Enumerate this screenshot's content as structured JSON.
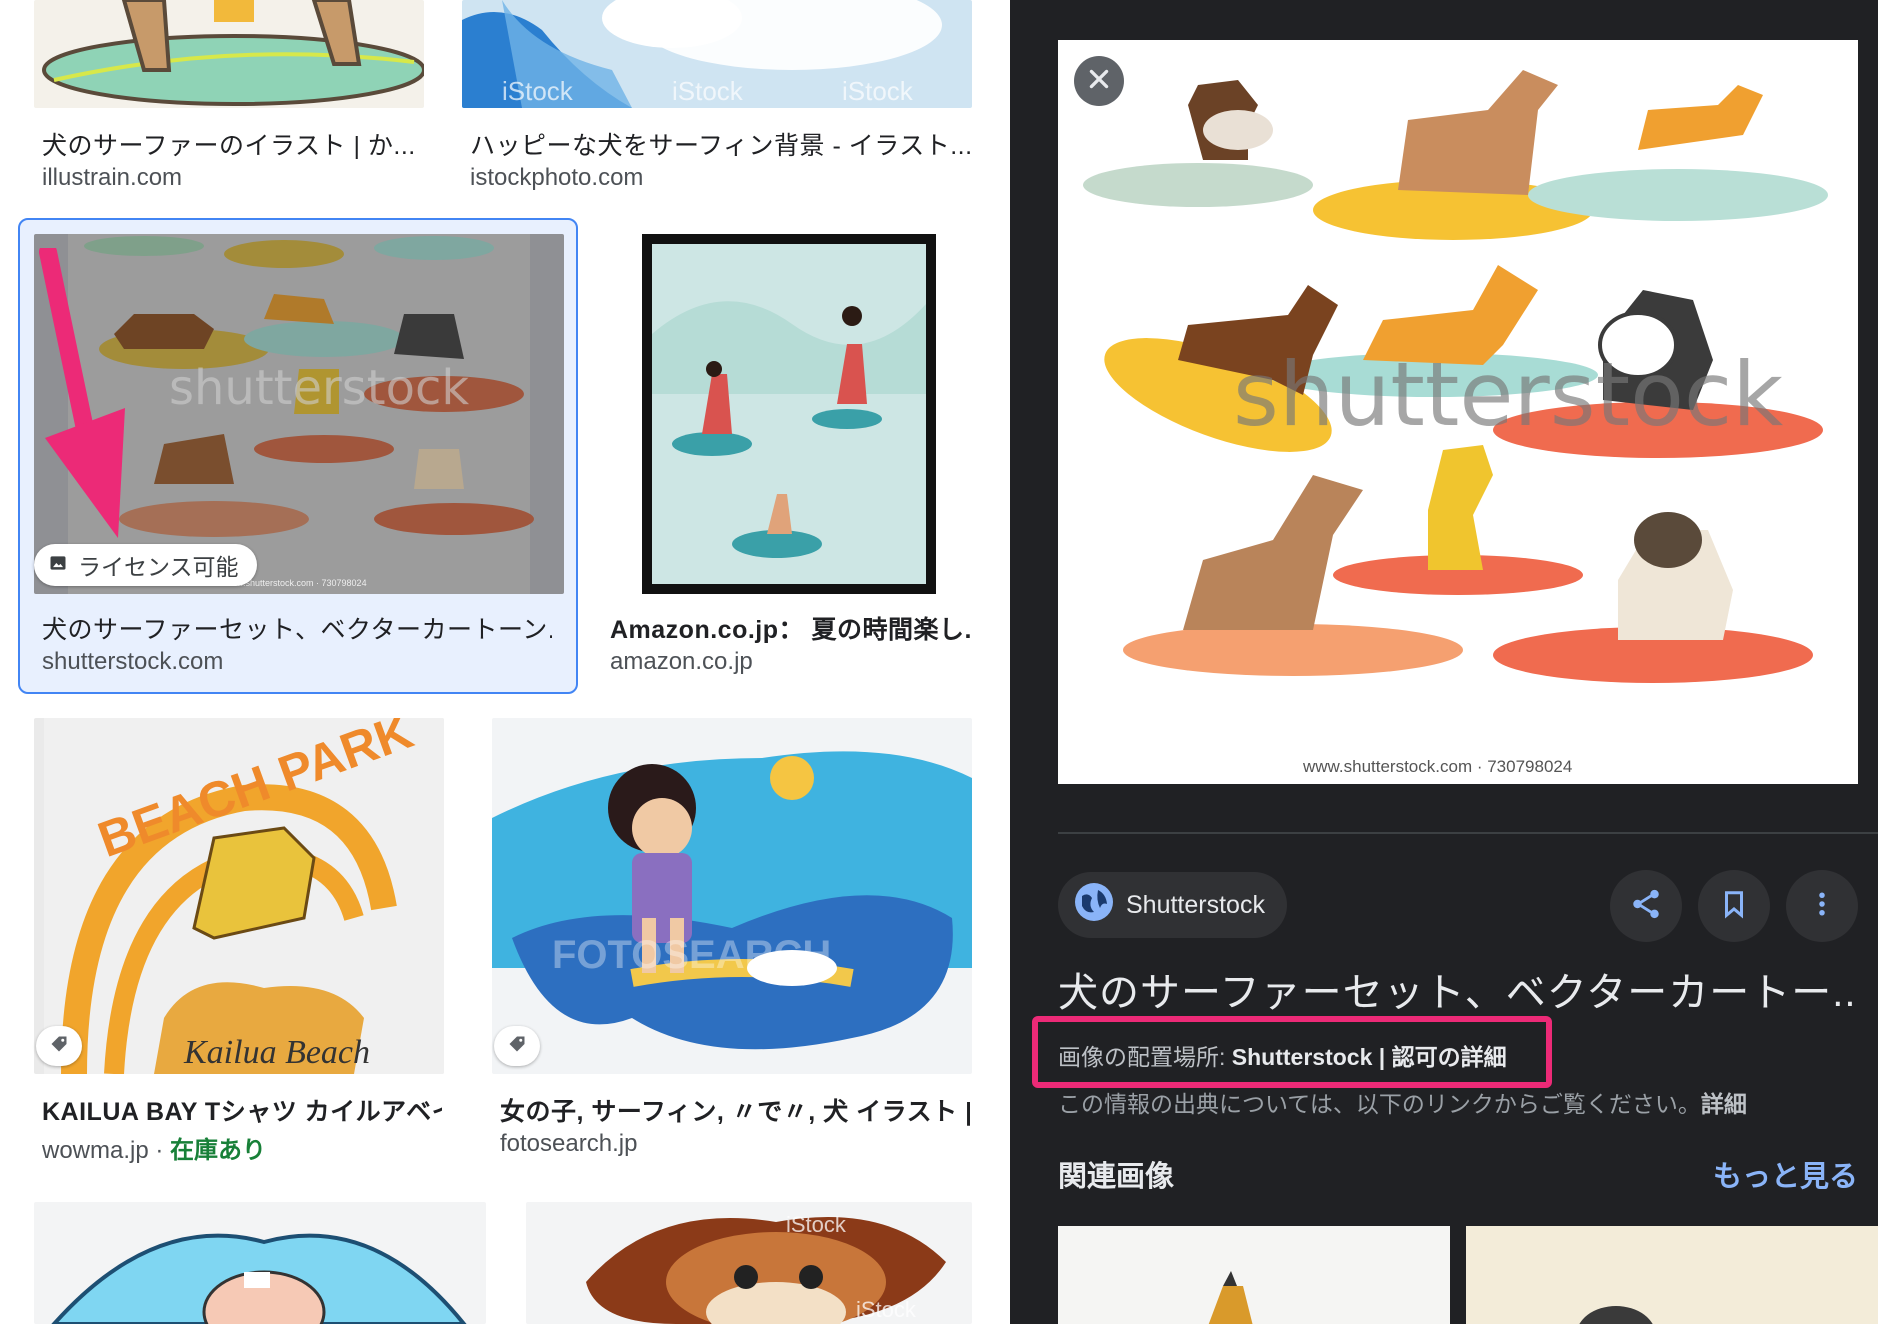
{
  "results": [
    {
      "title": "犬のサーファーのイラスト | か...",
      "source": "illustrain.com",
      "stock": ""
    },
    {
      "title": "ハッピーな犬をサーフィン背景 - イラスト...",
      "source": "istockphoto.com",
      "stock": ""
    },
    {
      "title": "犬のサーファーセット、ベクターカートーン...",
      "source": "shutterstock.com",
      "stock": "",
      "badge": "ライセンス可能",
      "selected": true
    },
    {
      "title": "Amazon.co.jp： 夏の時間楽し...",
      "source": "amazon.co.jp",
      "stock": ""
    },
    {
      "title": "KAILUA BAY Tシャツ カイルアベイ...",
      "source": "wowma.jp",
      "stock": "在庫あり",
      "stock_sep": " · "
    },
    {
      "title": "女の子, サーフィン, 〃で〃, 犬 イラスト |...",
      "source": "fotosearch.jp",
      "stock": ""
    }
  ],
  "thumb_text": {
    "istock_a": "iStock",
    "istock_b": "iStock",
    "istock_c": "iStock",
    "shutterstock_mark": "shutterstock",
    "beach_park": "BEACH PARK",
    "kailua": "Kailua Beach",
    "istock_d": "iStock",
    "istock_e": "iStock",
    "tiny_credit": "www.shutterstock.com · 730798024"
  },
  "preview": {
    "image_watermark": "shutterstock",
    "image_credit": "www.shutterstock.com · 730798024",
    "source_name": "Shutterstock",
    "title": "犬のサーファーセット、ベクターカートー...",
    "credit_label": "画像の配置場所: ",
    "credit_value": "Shutterstock | 認可の詳細",
    "info_text": "この情報の出典については、以下のリンクからご覧ください。",
    "info_link": "詳細",
    "related_heading": "関連画像",
    "more_link": "もっと見る"
  },
  "icons": {
    "close": "close-icon",
    "globe": "globe-icon",
    "share": "share-icon",
    "bookmark": "bookmark-icon",
    "more": "more-vert-icon",
    "image": "image-icon",
    "tag": "tag-icon"
  },
  "colors": {
    "selection": "#4285f4",
    "highlight_annotation": "#ec2a77",
    "link": "#8ab4f8",
    "in_stock": "#188038",
    "pane_bg": "#202124"
  }
}
